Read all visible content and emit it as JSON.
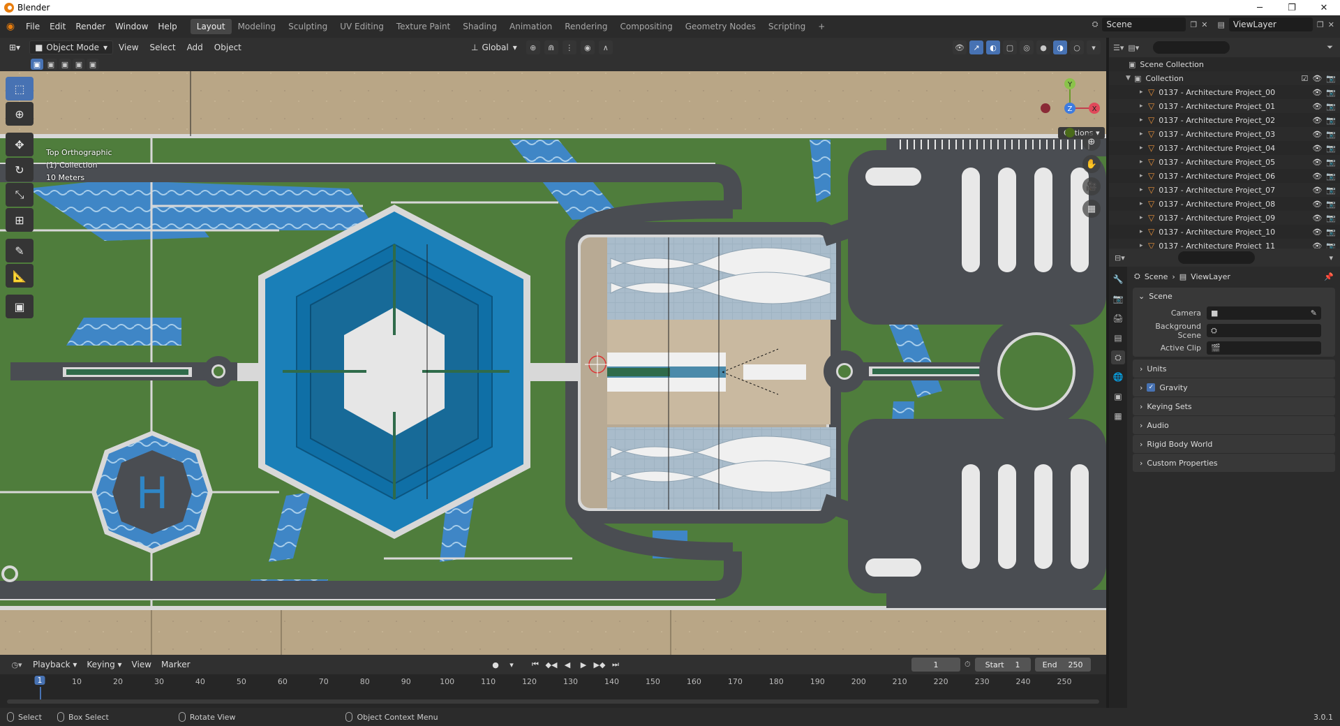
{
  "window": {
    "title": "Blender"
  },
  "menus": [
    "File",
    "Edit",
    "Render",
    "Window",
    "Help"
  ],
  "workspaces": [
    "Layout",
    "Modeling",
    "Sculpting",
    "UV Editing",
    "Texture Paint",
    "Shading",
    "Animation",
    "Rendering",
    "Compositing",
    "Geometry Nodes",
    "Scripting"
  ],
  "active_workspace": "Layout",
  "topright": {
    "scene": "Scene",
    "view_layer": "ViewLayer"
  },
  "viewport_header": {
    "mode": "Object Mode",
    "menus": [
      "View",
      "Select",
      "Add",
      "Object"
    ],
    "transform_orientation": "Global",
    "options": "Options"
  },
  "viewport_overlay": {
    "view_name": "Top Orthographic",
    "collection": "(1) Collection",
    "scale": "10 Meters"
  },
  "gizmo": {
    "y": "Y",
    "z": "Z",
    "x": "X"
  },
  "outliner": {
    "root": "Scene Collection",
    "collection": "Collection",
    "items": [
      "0137 - Architecture Project_00",
      "0137 - Architecture Project_01",
      "0137 - Architecture Project_02",
      "0137 - Architecture Project_03",
      "0137 - Architecture Project_04",
      "0137 - Architecture Project_05",
      "0137 - Architecture Project_06",
      "0137 - Architecture Project_07",
      "0137 - Architecture Project_08",
      "0137 - Architecture Project_09",
      "0137 - Architecture Project_10",
      "0137 - Architecture Project_11"
    ]
  },
  "properties": {
    "breadcrumb": {
      "scene": "Scene",
      "view_layer": "ViewLayer"
    },
    "panel_title": "Scene",
    "camera_label": "Camera",
    "background_scene_label": "Background Scene",
    "active_clip_label": "Active Clip",
    "subpanels": [
      "Units",
      "Gravity",
      "Keying Sets",
      "Audio",
      "Rigid Body World",
      "Custom Properties"
    ]
  },
  "timeline": {
    "menus": [
      "Playback",
      "Keying",
      "View",
      "Marker"
    ],
    "current_frame": "1",
    "start_label": "Start",
    "start": "1",
    "end_label": "End",
    "end": "250",
    "ticks": [
      "1",
      "10",
      "20",
      "30",
      "40",
      "50",
      "60",
      "70",
      "80",
      "90",
      "100",
      "110",
      "120",
      "130",
      "140",
      "150",
      "160",
      "170",
      "180",
      "190",
      "200",
      "210",
      "220",
      "230",
      "240",
      "250"
    ]
  },
  "statusbar": {
    "select": "Select",
    "box_select": "Box Select",
    "rotate_view": "Rotate View",
    "context_menu": "Object Context Menu",
    "version": "3.0.1"
  },
  "colors": {
    "accent": "#4772b3",
    "object_icon": "#e8913a",
    "grass": "#4f7d3c",
    "road": "#4a4d52",
    "water": "#3f86c6"
  }
}
